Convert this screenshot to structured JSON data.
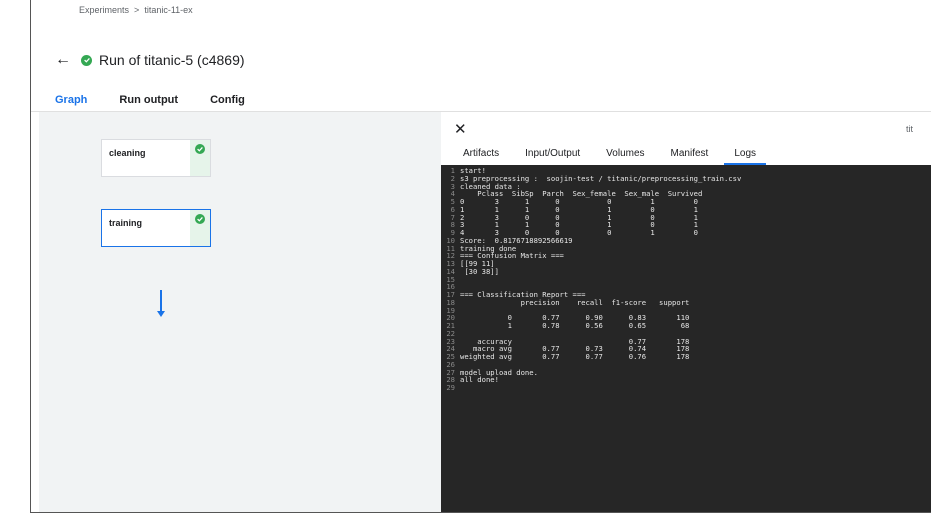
{
  "breadcrumb": {
    "root": "Experiments",
    "separator": ">",
    "current": "titanic-11-ex"
  },
  "header": {
    "title": "Run of titanic-5 (c4869)"
  },
  "tabs": [
    {
      "label": "Graph",
      "active": true
    },
    {
      "label": "Run output",
      "active": false
    },
    {
      "label": "Config",
      "active": false
    }
  ],
  "graph": {
    "nodes": [
      {
        "label": "cleaning",
        "status": "succeeded"
      },
      {
        "label": "training",
        "status": "succeeded"
      }
    ]
  },
  "panel": {
    "clipped_title": "tit",
    "tabs": [
      {
        "label": "Artifacts",
        "active": false
      },
      {
        "label": "Input/Output",
        "active": false
      },
      {
        "label": "Volumes",
        "active": false
      },
      {
        "label": "Manifest",
        "active": false
      },
      {
        "label": "Logs",
        "active": true
      }
    ],
    "logs": [
      "start!",
      "s3 preprocessing :  soojin-test / titanic/preprocessing_train.csv",
      "cleaned data :",
      "    Pclass  SibSp  Parch  Sex_female  Sex_male  Survived",
      "0       3      1      0           0         1         0",
      "1       1      1      0           1         0         1",
      "2       3      0      0           1         0         1",
      "3       1      1      0           1         0         1",
      "4       3      0      0           0         1         0",
      "Score:  0.8176718892566619",
      "training done",
      "=== Confusion Matrix ===",
      "[[99 11]",
      " [30 38]]",
      "",
      "",
      "=== Classification Report ===",
      "              precision    recall  f1-score   support",
      "",
      "           0       0.77      0.90      0.83       110",
      "           1       0.78      0.56      0.65        68",
      "",
      "    accuracy                           0.77       178",
      "   macro avg       0.77      0.73      0.74       178",
      "weighted avg       0.77      0.77      0.76       178",
      "",
      "model upload done.",
      "all done!",
      ""
    ]
  },
  "colors": {
    "accent": "#1a73e8",
    "success": "#34a853",
    "log_bg": "#262626",
    "graph_bg": "#f1f3f4"
  }
}
